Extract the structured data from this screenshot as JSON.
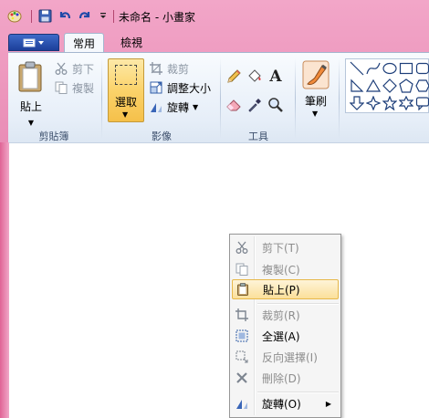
{
  "window": {
    "title": "未命名 - 小畫家"
  },
  "tabs": {
    "home": "常用",
    "view": "檢視"
  },
  "clipboard": {
    "paste_label": "貼上",
    "cut": "剪下",
    "copy": "複製",
    "group": "剪貼簿"
  },
  "image": {
    "select": "選取",
    "crop": "裁剪",
    "resize": "調整大小",
    "rotate": "旋轉",
    "group": "影像"
  },
  "tools": {
    "group": "工具",
    "text_glyph": "A"
  },
  "brushes": {
    "label": "筆刷"
  },
  "context_menu": {
    "items": [
      {
        "label": "剪下(T)",
        "icon": "scissors-icon",
        "enabled": false
      },
      {
        "label": "複製(C)",
        "icon": "copy-icon",
        "enabled": false
      },
      {
        "label": "貼上(P)",
        "icon": "paste-icon",
        "enabled": true,
        "highlighted": true
      },
      {
        "label": "裁剪(R)",
        "icon": "crop-icon",
        "enabled": false
      },
      {
        "label": "全選(A)",
        "icon": "select-all-icon",
        "enabled": true
      },
      {
        "label": "反向選擇(I)",
        "icon": "invert-selection-icon",
        "enabled": false
      },
      {
        "label": "刪除(D)",
        "icon": "delete-icon",
        "enabled": false
      },
      {
        "label": "旋轉(O)",
        "icon": "rotate-icon",
        "enabled": true,
        "submenu": true
      }
    ]
  },
  "colors": {
    "frame": "#e27aa8",
    "app_button": "#2a55b5",
    "selection_highlight": "#fbd36a"
  }
}
